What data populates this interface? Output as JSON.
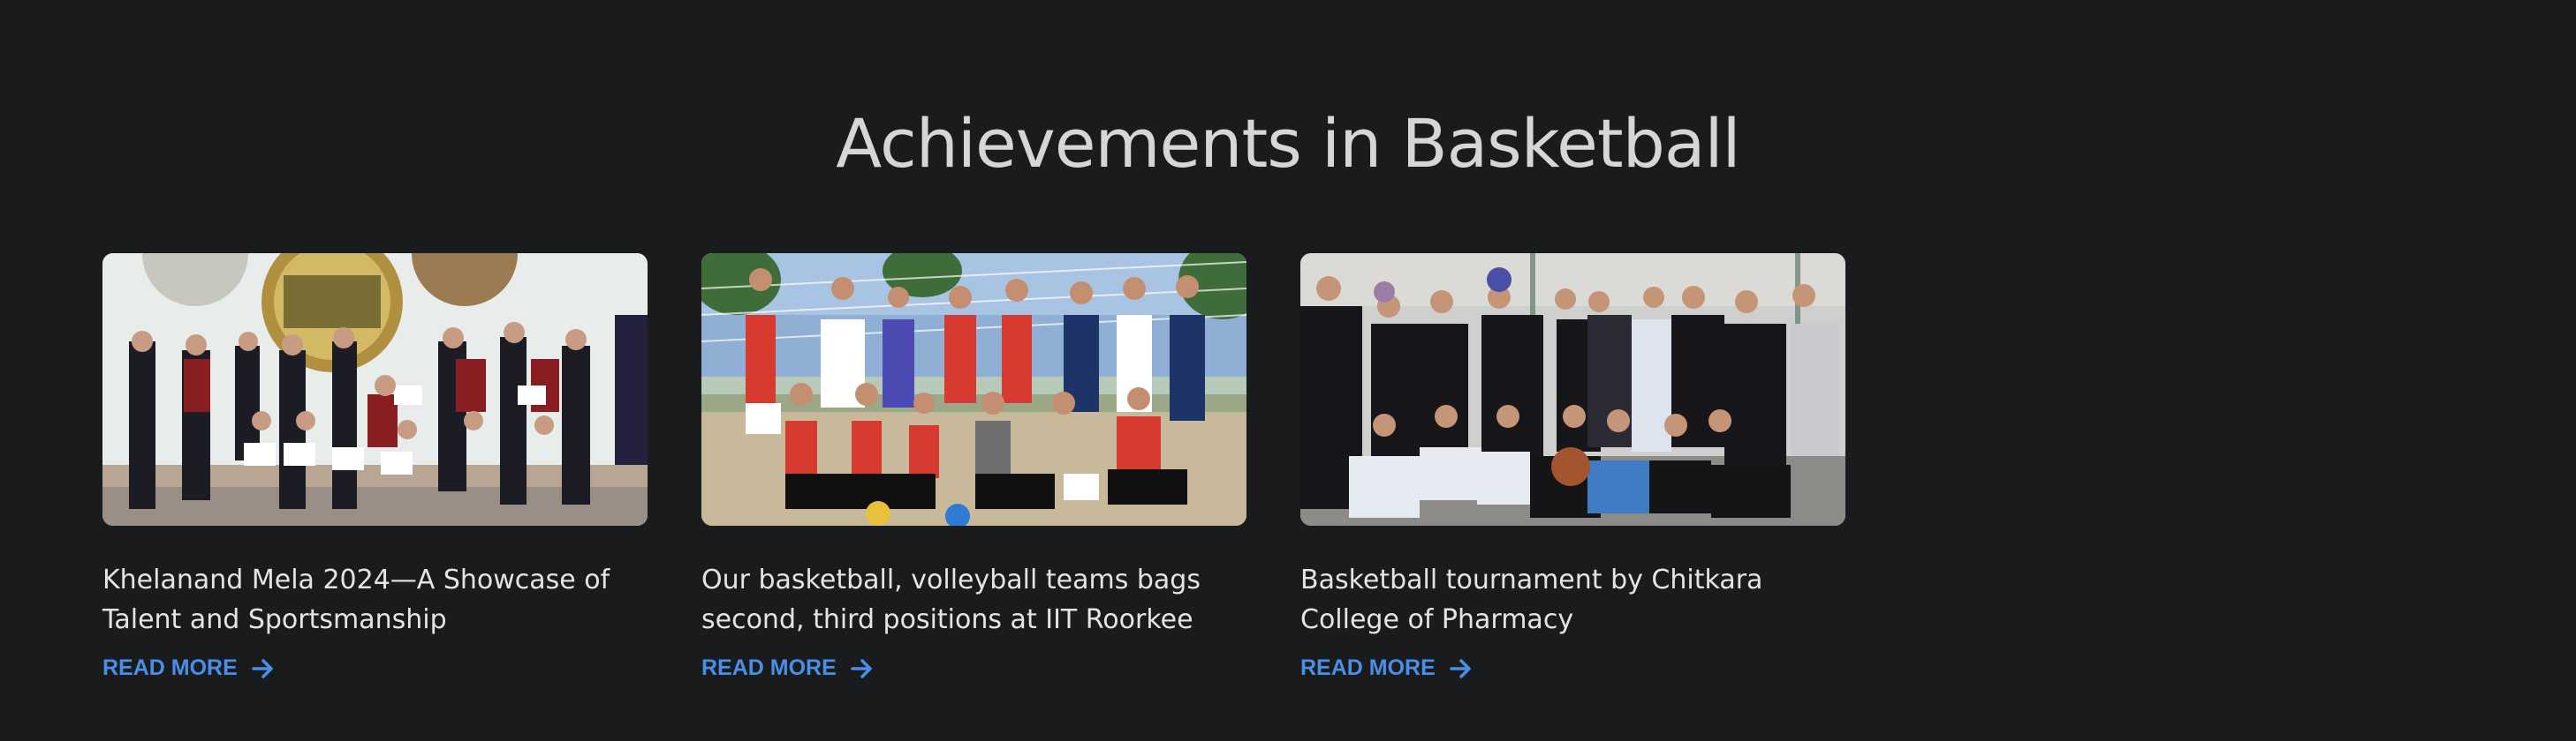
{
  "section": {
    "title": "Achievements in Basketball"
  },
  "colors": {
    "background": "#1a1b1d",
    "title": "#d6d6d6",
    "card_text": "#e4e4e4",
    "accent": "#4a8fe7"
  },
  "cards": [
    {
      "title": "Khelanand Mela 2024—A Showcase of Talent and Sportsmanship",
      "link_label": "READ MORE",
      "image_alt": "group-photo-with-certificates",
      "icon": "arrow-right-icon"
    },
    {
      "title": "Our basketball, volleyball teams bags second, third positions at IIT Roorkee",
      "link_label": "READ MORE",
      "image_alt": "team-photo-outdoor-court",
      "icon": "arrow-right-icon"
    },
    {
      "title": "Basketball tournament by Chitkara College of Pharmacy",
      "link_label": "READ MORE",
      "image_alt": "team-photo-indoor-court",
      "icon": "arrow-right-icon"
    }
  ]
}
